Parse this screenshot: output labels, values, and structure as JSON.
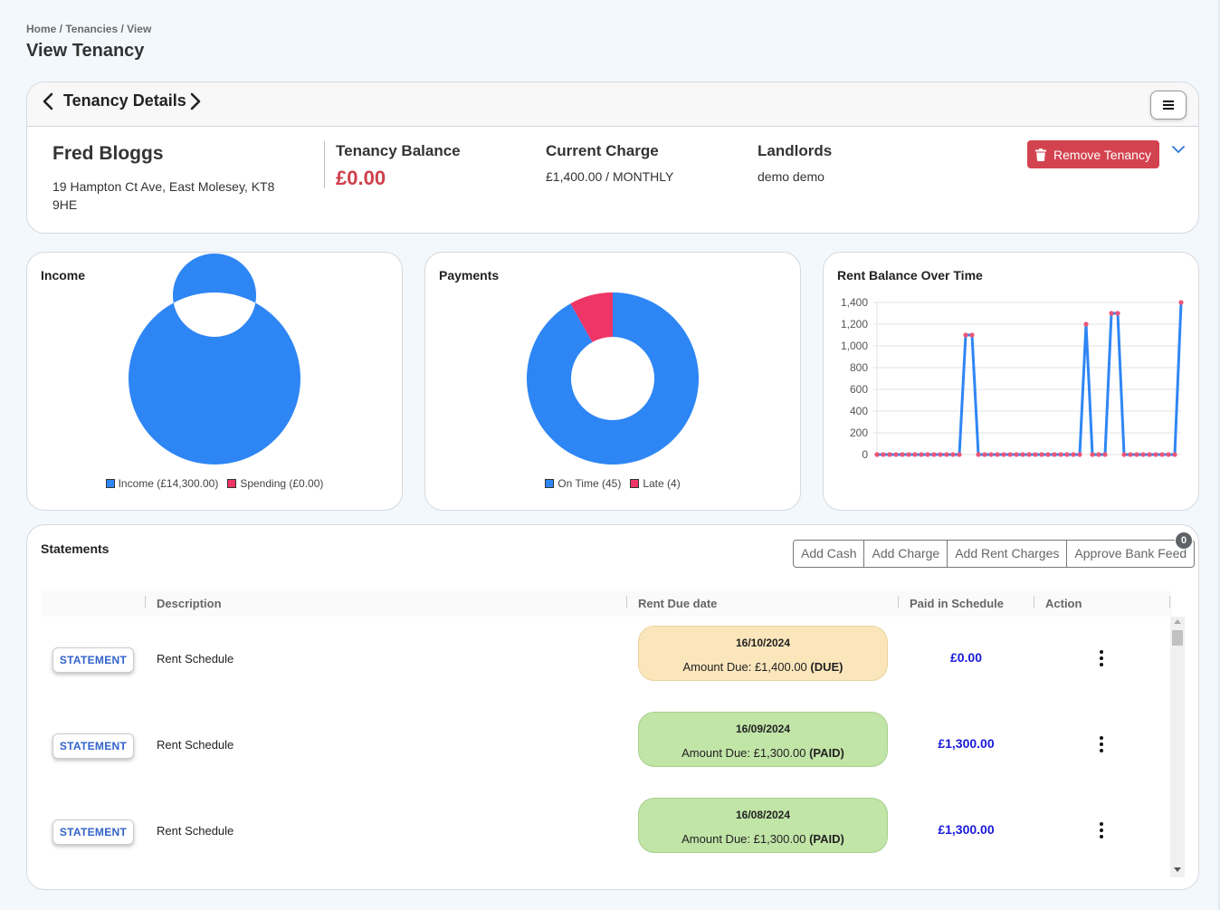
{
  "breadcrumb": "Home / Tenancies / View",
  "page_title": "View Tenancy",
  "details": {
    "title": "Tenancy Details",
    "tenant_name": "Fred Bloggs",
    "address": "19 Hampton Ct Ave, East Molesey, KT8 9HE",
    "balance_label": "Tenancy Balance",
    "balance_value": "£0.00",
    "charge_label": "Current Charge",
    "charge_value": "£1,400.00 / MONTHLY",
    "landlords_label": "Landlords",
    "landlords_value": "demo demo",
    "remove_label": "Remove Tenancy"
  },
  "colors": {
    "primary_blue": "#2e86f5",
    "pink": "#ee3566",
    "danger": "#d3434f",
    "due_bg": "#fbe6bb",
    "paid_bg": "#c1e4a7",
    "paid_text": "#1a1adb"
  },
  "chart_data": [
    {
      "type": "pie",
      "title": "Income",
      "labels": [
        "Income (£14,300.00)",
        "Spending (£0.00)"
      ],
      "values": [
        14300,
        0
      ],
      "colors": [
        "#2e86f5",
        "#ee3566"
      ],
      "legend": "bottom",
      "donut": true
    },
    {
      "type": "pie",
      "title": "Payments",
      "labels": [
        "On Time (45)",
        "Late (4)"
      ],
      "values": [
        45,
        4
      ],
      "colors": [
        "#2e86f5",
        "#ee3566"
      ],
      "legend": "bottom",
      "donut": true
    },
    {
      "type": "line",
      "title": "Rent Balance Over Time",
      "xlabel": "",
      "ylabel": "",
      "ylim": [
        0,
        1400
      ],
      "yticks": [
        "0",
        "200",
        "400",
        "600",
        "800",
        "1,000",
        "1,200",
        "1,400"
      ],
      "ytick_values": [
        0,
        200,
        400,
        600,
        800,
        1000,
        1200,
        1400
      ],
      "grid": true,
      "series": [
        {
          "name": "Rent Balance",
          "color": "#2e86f5",
          "marker_color": "#ee5577",
          "values": [
            0,
            0,
            0,
            0,
            0,
            0,
            0,
            0,
            0,
            0,
            0,
            0,
            0,
            0,
            1100,
            1100,
            0,
            0,
            0,
            0,
            0,
            0,
            0,
            0,
            0,
            0,
            0,
            0,
            0,
            0,
            0,
            0,
            0,
            1200,
            0,
            0,
            0,
            1300,
            1300,
            0,
            0,
            0,
            0,
            0,
            0,
            0,
            0,
            0,
            1400
          ]
        }
      ]
    }
  ],
  "statements": {
    "title": "Statements",
    "buttons": [
      "Add Cash",
      "Add Charge",
      "Add Rent Charges",
      "Approve Bank Feed"
    ],
    "bank_feed_badge": "0",
    "columns": [
      "Description",
      "Rent Due date",
      "Paid in Schedule",
      "Action"
    ],
    "rows": [
      {
        "type_label": "STATEMENT",
        "description": "Rent Schedule",
        "due_date": "16/10/2024",
        "amount_text": "Amount Due: £1,400.00 ",
        "status": "(DUE)",
        "status_class": "due",
        "paid": "£0.00"
      },
      {
        "type_label": "STATEMENT",
        "description": "Rent Schedule",
        "due_date": "16/09/2024",
        "amount_text": "Amount Due: £1,300.00 ",
        "status": "(PAID)",
        "status_class": "paid",
        "paid": "£1,300.00"
      },
      {
        "type_label": "STATEMENT",
        "description": "Rent Schedule",
        "due_date": "16/08/2024",
        "amount_text": "Amount Due: £1,300.00 ",
        "status": "(PAID)",
        "status_class": "paid",
        "paid": "£1,300.00"
      }
    ]
  }
}
